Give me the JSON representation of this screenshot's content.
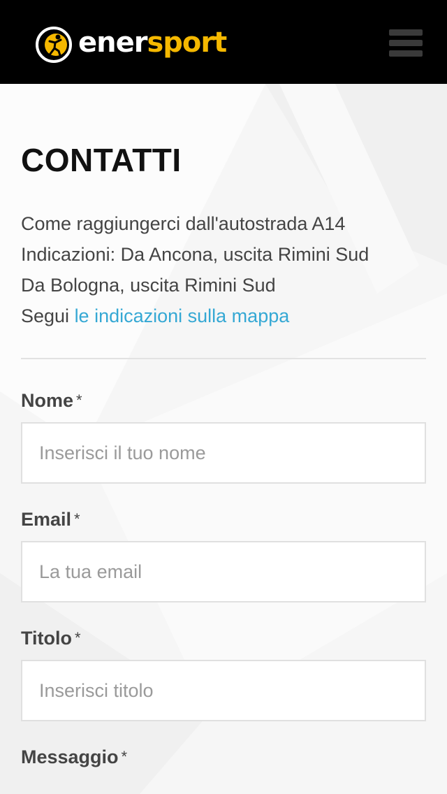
{
  "brand": {
    "logo_part1": "ener",
    "logo_part2": "sport",
    "colors": {
      "accent": "#f5b800",
      "header_bg": "#000000",
      "link": "#35a8d4"
    }
  },
  "header": {
    "menu_icon": "hamburger-icon"
  },
  "page": {
    "title": "CONTATTI",
    "info_lines": [
      "Come raggiungerci dall'autostrada A14",
      "Indicazioni: Da Ancona, uscita Rimini Sud",
      "Da Bologna, uscita Rimini Sud"
    ],
    "directions_prefix": "Segui ",
    "directions_link": "le indicazioni sulla mappa"
  },
  "form": {
    "required_mark": "*",
    "fields": [
      {
        "label": "Nome",
        "placeholder": "Inserisci il tuo nome",
        "value": ""
      },
      {
        "label": "Email",
        "placeholder": "La tua email",
        "value": ""
      },
      {
        "label": "Titolo",
        "placeholder": "Inserisci titolo",
        "value": ""
      },
      {
        "label": "Messaggio"
      }
    ]
  }
}
